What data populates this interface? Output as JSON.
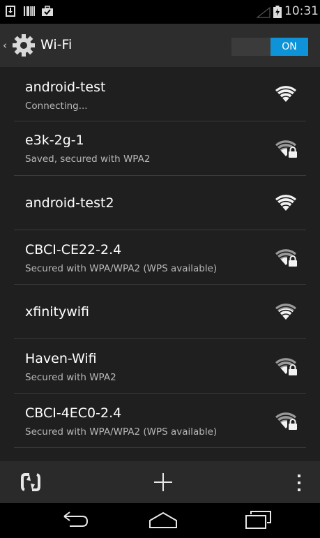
{
  "status_bar": {
    "time": "10:31",
    "icons": [
      "download-notification-icon",
      "barcode-notification-icon",
      "briefcase-notification-icon",
      "signal-icon",
      "battery-icon"
    ]
  },
  "action_bar": {
    "back_caret": "‹",
    "title": "Wi-Fi",
    "icon": "settings-gear-icon",
    "toggle_label": "ON",
    "toggle_state": "on",
    "accent_color": "#0f93d8"
  },
  "networks": [
    {
      "name": "android-test",
      "status": "Connecting...",
      "secured": false,
      "icon": "wifi-signal-icon"
    },
    {
      "name": "e3k-2g-1",
      "status": "Saved, secured with WPA2",
      "secured": true,
      "icon": "wifi-lock-icon"
    },
    {
      "name": "android-test2",
      "status": "",
      "secured": false,
      "icon": "wifi-signal-icon"
    },
    {
      "name": "CBCI-CE22-2.4",
      "status": "Secured with WPA/WPA2 (WPS available)",
      "secured": true,
      "icon": "wifi-lock-icon"
    },
    {
      "name": "xfinitywifi",
      "status": "",
      "secured": false,
      "icon": "wifi-signal-icon"
    },
    {
      "name": "Haven-Wifi",
      "status": "Secured with WPA2",
      "secured": true,
      "icon": "wifi-lock-icon"
    },
    {
      "name": "CBCI-4EC0-2.4",
      "status": "Secured with WPA/WPA2 (WPS available)",
      "secured": true,
      "icon": "wifi-lock-icon"
    }
  ],
  "bottom_bar": {
    "icons": [
      "scan-icon",
      "add-network-icon",
      "overflow-menu-icon"
    ]
  },
  "nav_bar": {
    "icons": [
      "back-icon",
      "home-icon",
      "recent-apps-icon"
    ]
  }
}
